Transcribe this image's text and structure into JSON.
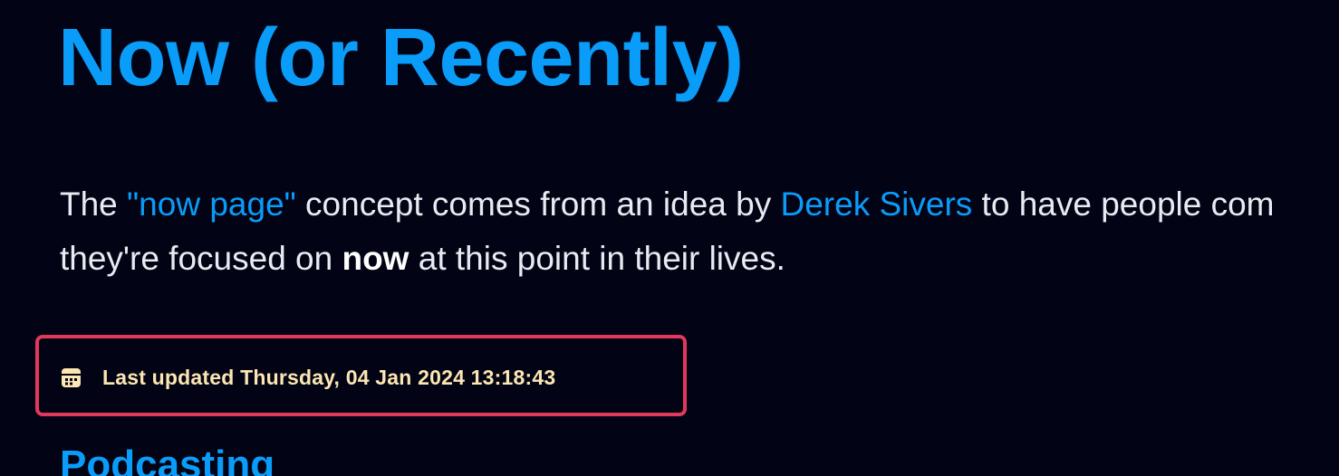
{
  "page": {
    "title": "Now (or Recently)",
    "intro": {
      "text_before_link1": "The ",
      "link1": "\"now page\"",
      "text_after_link1": " concept comes from an idea by ",
      "link2": "Derek Sivers",
      "text_after_link2": " to have people com",
      "text_line2_before_bold": "they're focused on ",
      "bold": "now",
      "text_line2_after_bold": " at this point in their lives."
    },
    "last_updated": {
      "icon": "calendar-icon",
      "text": "Last updated Thursday, 04 Jan 2024 13:18:43"
    },
    "section_heading": "Podcasting"
  },
  "colors": {
    "background": "#020314",
    "accent": "#0a9cf9",
    "highlight_border": "#e2385d",
    "updated_text": "#fce6b3"
  }
}
